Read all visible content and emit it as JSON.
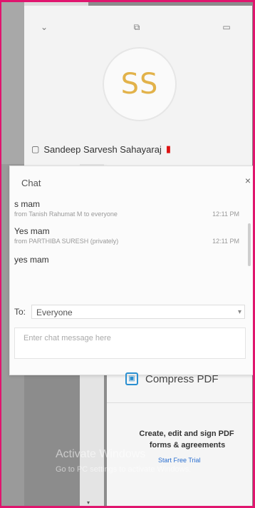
{
  "video": {
    "avatar_initials": "SS",
    "participant_name": "Sandeep Sarvesh Sahayaraj",
    "icons": [
      "chevron-down-icon",
      "copy-icon",
      "laptop-icon"
    ]
  },
  "chat": {
    "title": "Chat",
    "close": "×",
    "messages": [
      {
        "text": "s mam",
        "meta": "from Tanish Rahumat M to everyone",
        "time": "12:11 PM"
      },
      {
        "text": "Yes mam",
        "meta": "from PARTHIBA SURESH (privately)",
        "time": "12:11 PM"
      },
      {
        "text": "yes mam",
        "meta": "",
        "time": ""
      }
    ],
    "to_label": "To:",
    "to_value": "Everyone",
    "input_placeholder": "Enter chat message here"
  },
  "sidebar": {
    "compress_label": "Compress PDF",
    "promo_line1": "Create, edit and sign PDF",
    "promo_line2": "forms & agreements",
    "promo_link": "Start Free Trial"
  },
  "watermark": {
    "line1": "Activate Windows",
    "line2": "Go to PC settings to activate Windows."
  }
}
